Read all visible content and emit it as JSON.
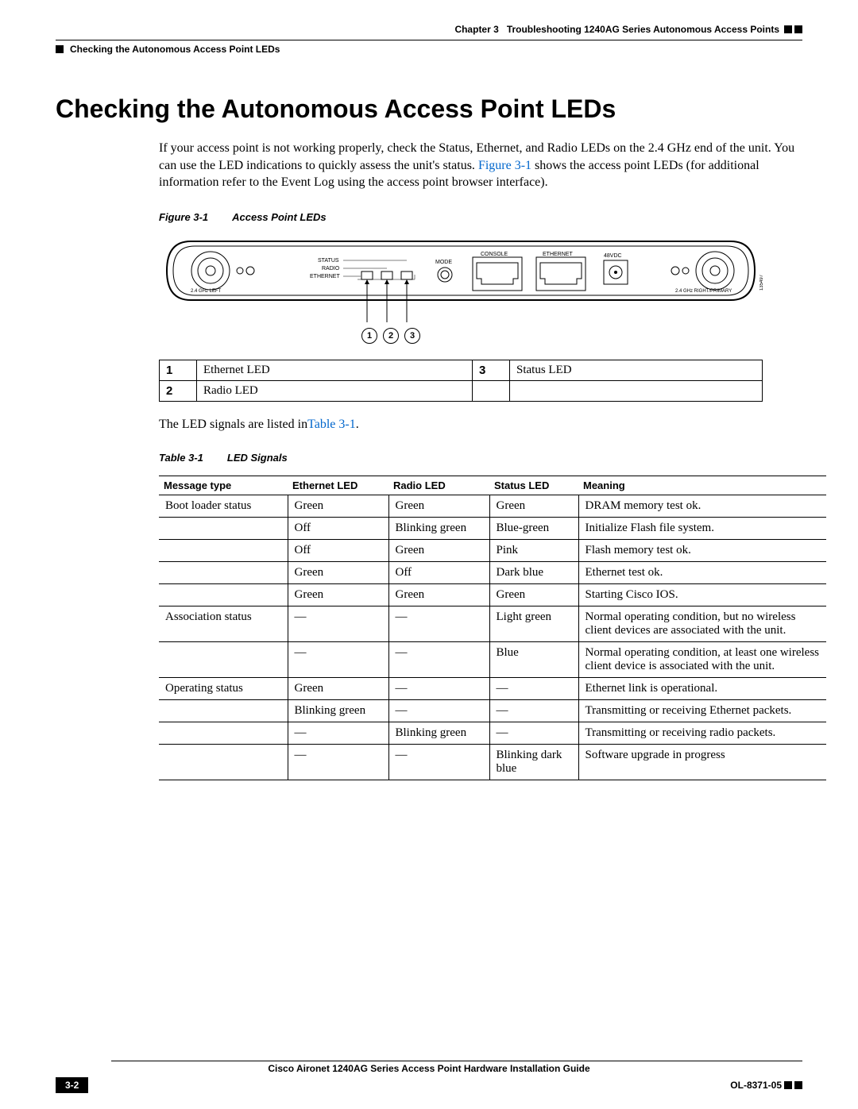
{
  "header": {
    "chapter": "Chapter 3",
    "chapter_title": "Troubleshooting 1240AG Series Autonomous Access Points",
    "section": "Checking the Autonomous Access Point LEDs"
  },
  "title": "Checking the Autonomous Access Point LEDs",
  "intro": {
    "part1": "If your access point is not working properly, check the Status, Ethernet, and Radio LEDs on the 2.4 GHz end of the unit. You can use the LED indications to quickly assess the unit's status. ",
    "fig_ref": "Figure 3-1",
    "part2": " shows the access point LEDs (for additional information refer to the Event Log using the access point browser interface)."
  },
  "figure": {
    "label": "Figure 3-1",
    "title": "Access Point LEDs",
    "diag_id": "135497",
    "labels": {
      "console": "CONSOLE",
      "ethernet": "ETHERNET",
      "vdc": "48VDC",
      "status": "STATUS",
      "radio": "RADIO",
      "eth": "ETHERNET",
      "mode": "MODE",
      "left": "2.4 GHz LEFT",
      "right": "2.4 GHz RIGHT/PRIMARY"
    },
    "callouts": [
      "1",
      "2",
      "3"
    ]
  },
  "legend": [
    {
      "n": "1",
      "v": "Ethernet LED"
    },
    {
      "n": "2",
      "v": "Radio LED"
    },
    {
      "n": "3",
      "v": "Status LED"
    }
  ],
  "para2": {
    "t1": "The LED signals are listed in",
    "ref": "Table 3-1",
    "t2": "."
  },
  "table": {
    "label": "Table 3-1",
    "title": "LED Signals",
    "headers": [
      "Message type",
      "Ethernet LED",
      "Radio LED",
      "Status LED",
      "Meaning"
    ],
    "rows": [
      {
        "g": true,
        "c": [
          "Boot loader status",
          "Green",
          "Green",
          "Green",
          "DRAM memory test ok."
        ]
      },
      {
        "c": [
          "",
          "Off",
          "Blinking green",
          "Blue-green",
          "Initialize Flash file system."
        ]
      },
      {
        "c": [
          "",
          "Off",
          "Green",
          "Pink",
          "Flash memory test ok."
        ]
      },
      {
        "c": [
          "",
          "Green",
          "Off",
          "Dark blue",
          "Ethernet test ok."
        ]
      },
      {
        "c": [
          "",
          "Green",
          "Green",
          "Green",
          "Starting Cisco IOS."
        ]
      },
      {
        "g": true,
        "c": [
          "Association status",
          "—",
          "—",
          "Light green",
          "Normal operating condition, but no wireless client devices are associated with the unit."
        ]
      },
      {
        "c": [
          "",
          "—",
          "—",
          "Blue",
          "Normal operating condition, at least one wireless client device is associated with the unit."
        ]
      },
      {
        "g": true,
        "c": [
          "Operating status",
          "Green",
          "—",
          "—",
          "Ethernet link is operational."
        ]
      },
      {
        "c": [
          "",
          "Blinking green",
          "—",
          "—",
          "Transmitting or receiving Ethernet packets."
        ]
      },
      {
        "c": [
          "",
          "—",
          "Blinking green",
          "—",
          "Transmitting or receiving radio packets."
        ]
      },
      {
        "c": [
          "",
          "—",
          "—",
          "Blinking dark blue",
          "Software upgrade in progress"
        ]
      }
    ]
  },
  "footer": {
    "book": "Cisco Aironet 1240AG Series Access Point Hardware Installation Guide",
    "page": "3-2",
    "doc": "OL-8371-05"
  }
}
